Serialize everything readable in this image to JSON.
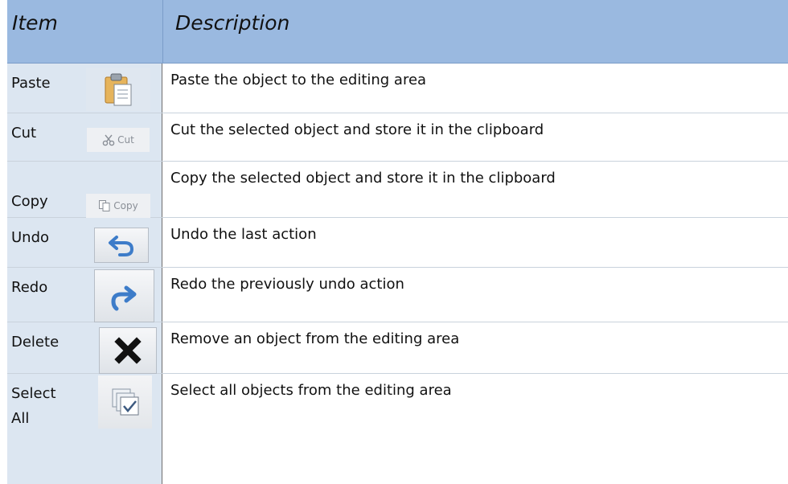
{
  "header": {
    "item": "Item",
    "description": "Description"
  },
  "rows": [
    {
      "item": "Paste",
      "description": "Paste the object to the editing area",
      "icon": "paste-icon"
    },
    {
      "item": "Cut",
      "description": "Cut the selected object and store it in the clipboard",
      "icon": "scissors-icon",
      "icon_text": "Cut"
    },
    {
      "item": "Copy",
      "description": "Copy the selected object and store it in the clipboard",
      "icon": "copy-icon",
      "icon_text": "Copy"
    },
    {
      "item": "Undo",
      "description": "Undo the last action",
      "icon": "undo-icon"
    },
    {
      "item": "Redo",
      "description": "Redo the previously undo action",
      "icon": "redo-icon"
    },
    {
      "item": "Delete",
      "description": "Remove an object from the editing area",
      "icon": "delete-x-icon"
    },
    {
      "item": "Select All",
      "description": "Select all objects from the editing area",
      "icon": "select-all-icon"
    }
  ],
  "colors": {
    "header_bg": "#9ab9e0",
    "item_bg": "#dce6f1",
    "accent_icon": "#3d7cc9"
  }
}
